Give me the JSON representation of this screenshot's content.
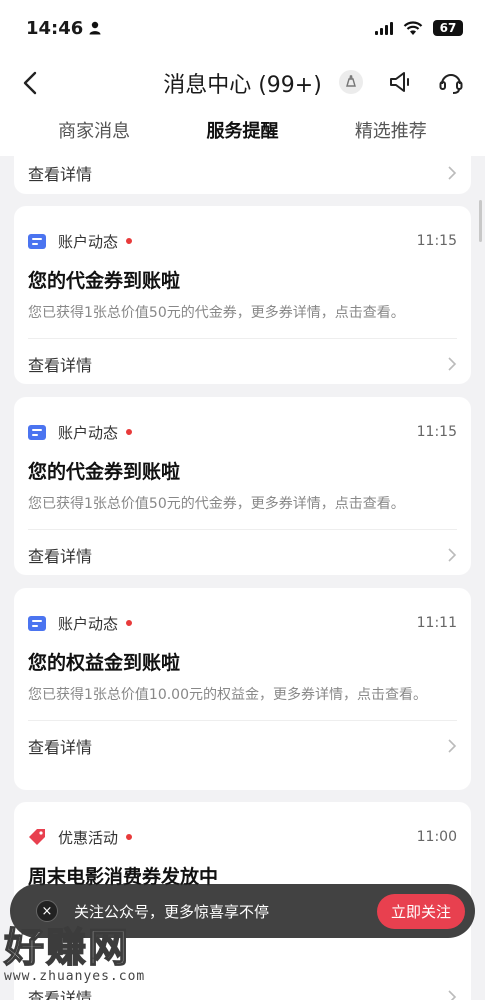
{
  "status_bar": {
    "time": "14:46",
    "battery": "67"
  },
  "nav": {
    "title": "消息中心 (99+)"
  },
  "tabs": [
    {
      "label": "商家消息"
    },
    {
      "label": "服务提醒",
      "active": true
    },
    {
      "label": "精选推荐"
    }
  ],
  "partial_card": {
    "footer": "查看详情"
  },
  "cards": [
    {
      "category": "账户动态",
      "time": "11:15",
      "title": "您的代金券到账啦",
      "desc": "您已获得1张总价值50元的代金券，更多券详情，点击查看。",
      "footer": "查看详情"
    },
    {
      "category": "账户动态",
      "time": "11:15",
      "title": "您的代金券到账啦",
      "desc": "您已获得1张总价值50元的代金券，更多券详情，点击查看。",
      "footer": "查看详情"
    },
    {
      "category": "账户动态",
      "time": "11:11",
      "title": "您的权益金到账啦",
      "desc": "您已获得1张总价值10.00元的权益金，更多券详情，点击查看。",
      "footer": "查看详情"
    },
    {
      "category": "优惠活动",
      "time": "11:00",
      "title": "周末电影消费券发放中",
      "desc": "",
      "footer": "查看详情"
    }
  ],
  "toast": {
    "close": "×",
    "text": "关注公众号，更多惊喜享不停",
    "button": "立即关注"
  },
  "watermark": {
    "big": "好赚网",
    "small": "www.zhuanyes.com"
  },
  "colors": {
    "accent": "#e8404f",
    "category_blue": "#4b74f0",
    "dot_red": "#e83a3a"
  }
}
